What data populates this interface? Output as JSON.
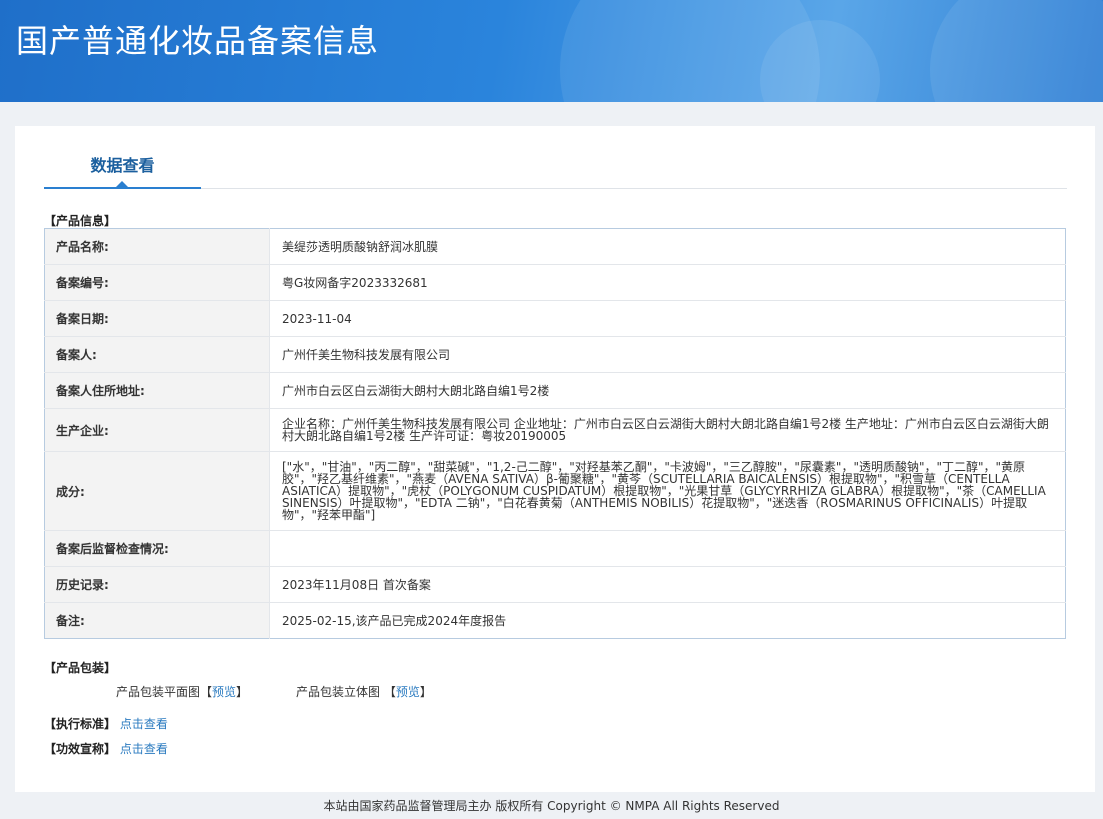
{
  "header": {
    "title": "国产普通化妆品备案信息"
  },
  "tabs": [
    {
      "label": "数据查看"
    }
  ],
  "product_info": {
    "section_label": "【产品信息】",
    "rows": [
      {
        "label": "产品名称:",
        "value": "美缇莎透明质酸钠舒润冰肌膜"
      },
      {
        "label": "备案编号:",
        "value": "粤G妆网备字2023332681"
      },
      {
        "label": "备案日期:",
        "value": "2023-11-04"
      },
      {
        "label": "备案人:",
        "value": "广州仟美生物科技发展有限公司"
      },
      {
        "label": "备案人住所地址:",
        "value": "广州市白云区白云湖街大朗村大朗北路自编1号2楼"
      },
      {
        "label": "生产企业:",
        "value": "企业名称：广州仟美生物科技发展有限公司 企业地址：广州市白云区白云湖街大朗村大朗北路自编1号2楼 生产地址：广州市白云区白云湖街大朗村大朗北路自编1号2楼 生产许可证：粤妆20190005"
      },
      {
        "label": "成分:",
        "value": "[\"水\"，\"甘油\"，\"丙二醇\"，\"甜菜碱\"，\"1,2-己二醇\"，\"对羟基苯乙酮\"，\"卡波姆\"，\"三乙醇胺\"，\"尿囊素\"，\"透明质酸钠\"，\"丁二醇\"，\"黄原胶\"，\"羟乙基纤维素\"，\"燕麦（AVENA SATIVA）β-葡聚糖\"，\"黄芩（SCUTELLARIA BAICALENSIS）根提取物\"，\"积雪草（CENTELLA ASIATICA）提取物\"，\"虎杖（POLYGONUM CUSPIDATUM）根提取物\"，\"光果甘草（GLYCYRRHIZA GLABRA）根提取物\"，\"茶（CAMELLIA SINENSIS）叶提取物\"，\"EDTA 二钠\"，\"白花春黄菊（ANTHEMIS NOBILIS）花提取物\"，\"迷迭香（ROSMARINUS OFFICINALIS）叶提取物\"，\"羟苯甲酯\"]"
      },
      {
        "label": "备案后监督检查情况:",
        "value": ""
      },
      {
        "label": "历史记录:",
        "value": "2023年11月08日 首次备案"
      },
      {
        "label": "备注:",
        "value": "2025-02-15,该产品已完成2024年度报告"
      }
    ]
  },
  "packaging": {
    "section_label": "【产品包装】",
    "flat_label": "产品包装平面图",
    "flat_link": "预览",
    "solid_label": "产品包装立体图",
    "solid_link": "预览",
    "bracket_open": "【",
    "bracket_close": "】"
  },
  "standard": {
    "label": "【执行标准】",
    "link": "点击查看"
  },
  "efficacy": {
    "label": "【功效宣称】",
    "link": "点击查看"
  },
  "footer": {
    "text": "本站由国家药品监督管理局主办 版权所有 Copyright © NMPA All Rights Reserved"
  }
}
